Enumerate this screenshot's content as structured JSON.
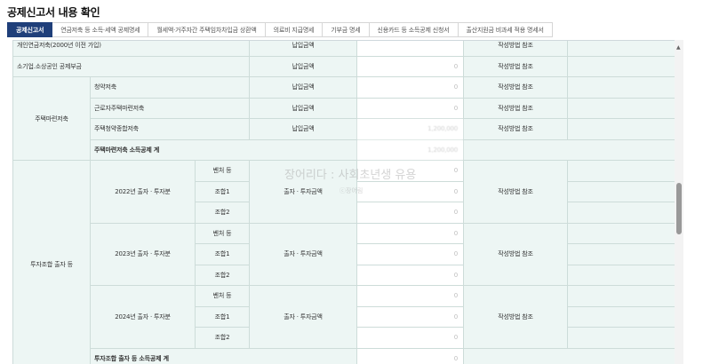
{
  "page": {
    "title": "공제신고서 내용 확인"
  },
  "tabs": [
    {
      "label": "공제신고서",
      "active": true
    },
    {
      "label": "연금저축 등 소득·세액 공제명세"
    },
    {
      "label": "월세액·거주자간 주택임차차입금 상환액"
    },
    {
      "label": "의료비 지급명세"
    },
    {
      "label": "기부금 명세"
    },
    {
      "label": "신용카드 등 소득공제 신청서"
    },
    {
      "label": "출산지원금 비과세 적용 명세서"
    }
  ],
  "table": {
    "top_partial": {
      "label": "개인연금저축(2000년 이전 가입)",
      "col3": "납입금액",
      "note": "작성방법 참조"
    },
    "small_business": {
      "label": "소기업.소상공인 공제부금",
      "col3": "납입금액",
      "amount": "0",
      "note": "작성방법 참조"
    },
    "housing": {
      "group_label": "주택마련저축",
      "rows": [
        {
          "label": "청약저축",
          "col3": "납입금액",
          "amount": "0",
          "note": "작성방법 참조"
        },
        {
          "label": "근로자주택마련저축",
          "col3": "납입금액",
          "amount": "0",
          "note": "작성방법 참조"
        },
        {
          "label": "주택청약종합저축",
          "col3": "납입금액",
          "amount": "1,200,000",
          "note": "작성방법 참조"
        }
      ],
      "subtotal": {
        "label": "주택마련저축 소득공제 계",
        "amount": "1,200,000"
      }
    },
    "investment": {
      "group_label": "투자조합 출자 등",
      "years": [
        {
          "label": "2022년 출자 · 투자분",
          "col3": "출자 · 투자금액",
          "note": "작성방법 참조",
          "subs": [
            {
              "label": "벤처 등",
              "amount": "0"
            },
            {
              "label": "조합1",
              "amount": "0"
            },
            {
              "label": "조합2",
              "amount": "0"
            }
          ]
        },
        {
          "label": "2023년 출자 · 투자분",
          "col3": "출자 · 투자금액",
          "note": "작성방법 참조",
          "subs": [
            {
              "label": "벤처 등",
              "amount": "0"
            },
            {
              "label": "조합1",
              "amount": "0"
            },
            {
              "label": "조합2",
              "amount": "0"
            }
          ]
        },
        {
          "label": "2024년 출자 · 투자분",
          "col3": "출자 · 투자금액",
          "note": "작성방법 참조",
          "subs": [
            {
              "label": "벤처 등",
              "amount": "0"
            },
            {
              "label": "조합1",
              "amount": "0"
            },
            {
              "label": "조합2",
              "amount": "0"
            }
          ]
        }
      ],
      "subtotal": {
        "label": "투자조합 출자 등 소득공제 계",
        "amount": "0"
      }
    }
  },
  "watermark": {
    "text": "장어리다 : 사회초년생 유용",
    "sub": "ⓒ장어림"
  }
}
